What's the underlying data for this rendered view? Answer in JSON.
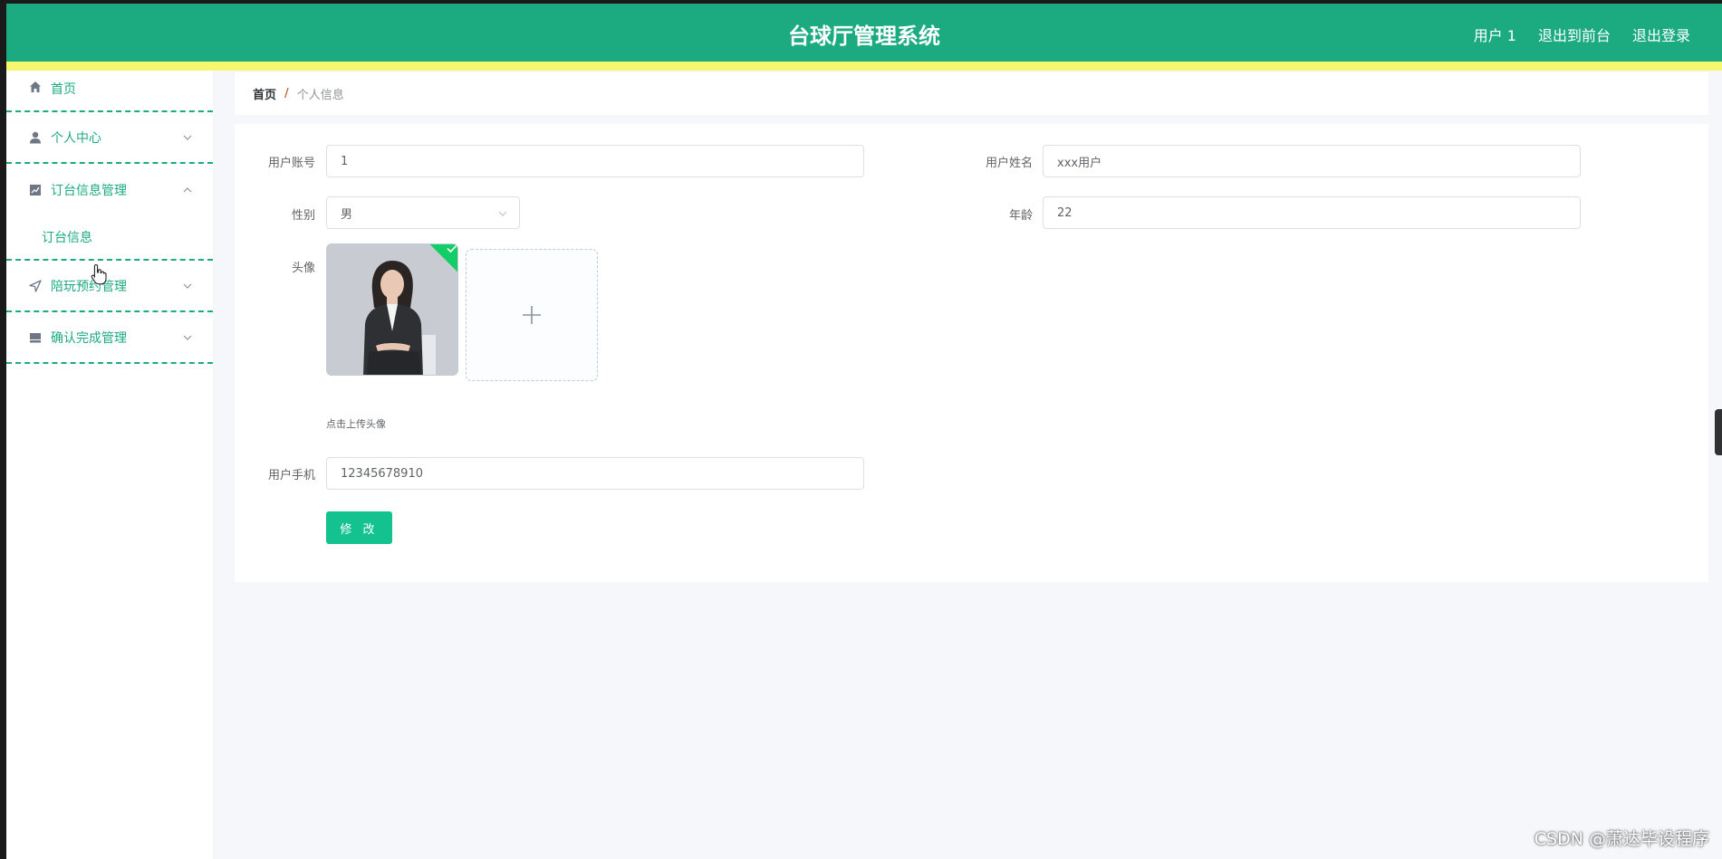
{
  "header": {
    "title": "台球厅管理系统",
    "user": "用户 1",
    "back_front": "退出到前台",
    "logout": "退出登录",
    "color": "#1caa80"
  },
  "sidebar": {
    "items": [
      {
        "label": "首页",
        "icon": "home-icon"
      },
      {
        "label": "个人中心",
        "icon": "user-icon",
        "expanded": false
      },
      {
        "label": "订台信息管理",
        "icon": "chart-icon",
        "expanded": true,
        "children": [
          {
            "label": "订台信息"
          }
        ]
      },
      {
        "label": "陪玩预约管理",
        "icon": "navigation-icon",
        "expanded": false
      },
      {
        "label": "确认完成管理",
        "icon": "inbox-icon",
        "expanded": false
      }
    ]
  },
  "breadcrumb": {
    "home": "首页",
    "separator": "/",
    "current": "个人信息"
  },
  "form": {
    "account_label": "用户账号",
    "account_value": "1",
    "name_label": "用户姓名",
    "name_value": "xxx用户",
    "gender_label": "性别",
    "gender_value": "男",
    "age_label": "年龄",
    "age_value": "22",
    "avatar_label": "头像",
    "avatar_hint": "点击上传头像",
    "phone_label": "用户手机",
    "phone_value": "12345678910",
    "submit_label": "修 改"
  },
  "watermark": "CSDN @萧达毕设程序"
}
